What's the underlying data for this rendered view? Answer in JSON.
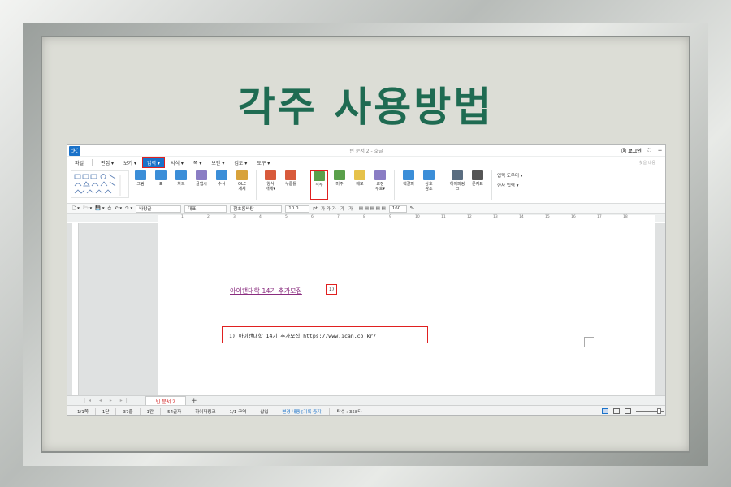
{
  "headline": "각주 사용방법",
  "app": {
    "logo": "ℋ",
    "doc_title": "빈 문서 2 - 호글",
    "login": "ⓧ 로그인",
    "menus": [
      "파일",
      "편집 ▾",
      "보기 ▾",
      "입력 ▾",
      "서식 ▾",
      "쪽 ▾",
      "보안 ▾",
      "검토 ▾",
      "도구 ▾"
    ],
    "active_menu_index": 3,
    "menu_right": "찾을 내용",
    "ribbon": [
      {
        "label": "그림",
        "color": "#3b8ed8"
      },
      {
        "label": "표",
        "color": "#3b8ed8"
      },
      {
        "label": "차트",
        "color": "#3b8ed8"
      },
      {
        "label": "글맵시",
        "color": "#8a7dc4"
      },
      {
        "label": "수식",
        "color": "#3b8ed8"
      },
      {
        "label": "OLE\n개체",
        "color": "#d8a23b"
      },
      {
        "label": "양식\n개체▾",
        "color": "#d85a3b"
      },
      {
        "label": "누름틀",
        "color": "#d85a3b"
      },
      {
        "label": "각주",
        "color": "#5aa04a",
        "highlight": true
      },
      {
        "label": "미주",
        "color": "#5aa04a"
      },
      {
        "label": "메모",
        "color": "#e6c24a"
      },
      {
        "label": "교정\n부호▾",
        "color": "#8a7dc4"
      },
      {
        "label": "책갈피",
        "color": "#3b8ed8"
      },
      {
        "label": "상호\n참조",
        "color": "#3b8ed8"
      },
      {
        "label": "하이퍼링크",
        "color": "#5a6d80"
      },
      {
        "label": "문자표",
        "color": "#555555"
      }
    ],
    "small_ops": [
      "입력 도우미 ▾",
      "한자 입력 ▾"
    ],
    "fmtbar": {
      "style": "바탕글",
      "lang": "대표",
      "font": "함초롬바탕",
      "size": "10.0",
      "unit": "pt",
      "glyphs": "가 가 가 · 가 · 가 ·",
      "zoom": "160",
      "percent": "%"
    },
    "ruler_ticks": [
      "1",
      "2",
      "3",
      "4",
      "5",
      "6",
      "7",
      "8",
      "9",
      "10",
      "11",
      "12",
      "13",
      "14",
      "15",
      "16",
      "17",
      "18"
    ],
    "body_text": "아이캔대학 14기 추가모집",
    "footnote_ref": "1)",
    "footnote_text": "1) 아이캔대학 14기 추가모집 https://www.ican.co.kr/",
    "tab_nav": "|◂ ◂ ▸ ▸|",
    "doc_tab": "빈 문서 2",
    "tab_add": "+",
    "status": [
      "1/1쪽",
      "1단",
      "37줄",
      "1칸",
      "54글자",
      "하이퍼링크",
      "1/1 구역",
      "삽입"
    ],
    "status_blue": "변경 내용 [기록 중지]",
    "status_end": "탁수 : 358타"
  }
}
